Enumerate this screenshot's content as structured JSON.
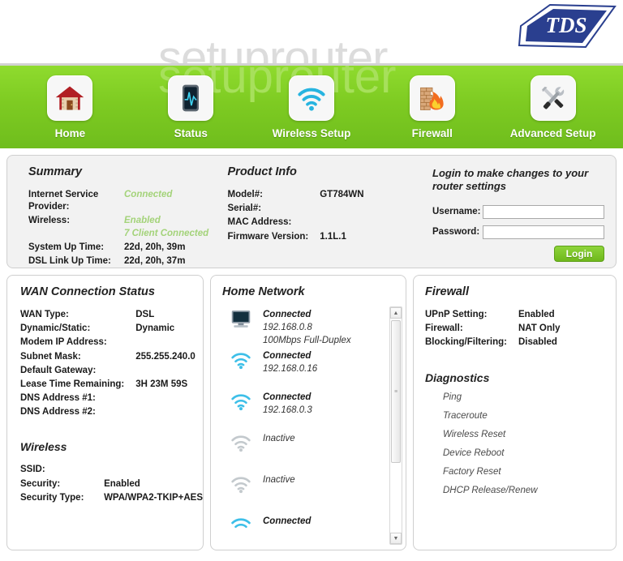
{
  "header": {
    "brand": "TDS",
    "watermark": "setuprouter"
  },
  "nav": {
    "items": [
      {
        "label": "Home",
        "icon": "house-icon"
      },
      {
        "label": "Status",
        "icon": "pulse-monitor-icon"
      },
      {
        "label": "Wireless Setup",
        "icon": "wifi-icon"
      },
      {
        "label": "Firewall",
        "icon": "firewall-flame-icon"
      },
      {
        "label": "Advanced Setup",
        "icon": "tools-icon"
      }
    ]
  },
  "summary": {
    "title": "Summary",
    "rows": [
      {
        "key": "Internet Service Provider:",
        "value": "Connected",
        "style": "green"
      },
      {
        "key": "Wireless:",
        "value": "Enabled\n7 Client Connected",
        "style": "green"
      },
      {
        "key": "System Up Time:",
        "value": "22d, 20h, 39m",
        "style": "plain"
      },
      {
        "key": "DSL Link Up Time:",
        "value": "22d, 20h, 37m",
        "style": "plain"
      }
    ]
  },
  "product_info": {
    "title": "Product Info",
    "rows": [
      {
        "key": "Model#:",
        "value": "GT784WN"
      },
      {
        "key": "Serial#:",
        "value": ""
      },
      {
        "key": "MAC Address:",
        "value": ""
      },
      {
        "key": "Firmware Version:",
        "value": "1.1L.1"
      }
    ]
  },
  "login": {
    "title": "Login to make changes to your router settings",
    "username_label": "Username:",
    "username_value": "",
    "username_placeholder": "",
    "password_label": "Password:",
    "password_value": "",
    "password_placeholder": "",
    "button_label": "Login",
    "button_color": "#7ec81f"
  },
  "wan": {
    "title": "WAN Connection Status",
    "rows": [
      {
        "key": "WAN Type:",
        "value": "DSL"
      },
      {
        "key": "Dynamic/Static:",
        "value": "Dynamic"
      },
      {
        "key": "Modem IP Address:",
        "value": ""
      },
      {
        "key": "Subnet Mask:",
        "value": "255.255.240.0"
      },
      {
        "key": "Default Gateway:",
        "value": ""
      },
      {
        "key": "Lease Time Remaining:",
        "value": "3H 23M 59S"
      },
      {
        "key": "DNS Address #1:",
        "value": ""
      },
      {
        "key": "DNS Address #2:",
        "value": ""
      }
    ],
    "wireless_title": "Wireless",
    "wireless_rows": [
      {
        "key": "SSID:",
        "value": ""
      },
      {
        "key": "Security:",
        "value": "Enabled"
      },
      {
        "key": "Security Type:",
        "value": "WPA/WPA2-TKIP+AES"
      }
    ]
  },
  "home_network": {
    "title": "Home Network",
    "devices": [
      {
        "icon": "computer-icon",
        "status": "Connected",
        "ip": "192.168.0.8",
        "speed": "100Mbps Full-Duplex",
        "active": true
      },
      {
        "icon": "wifi-icon",
        "status": "Connected",
        "ip": "192.168.0.16",
        "speed": "",
        "active": true
      },
      {
        "icon": "wifi-icon",
        "status": "Connected",
        "ip": "192.168.0.3",
        "speed": "",
        "active": true
      },
      {
        "icon": "wifi-icon",
        "status": "Inactive",
        "ip": "",
        "speed": "",
        "active": false
      },
      {
        "icon": "wifi-icon",
        "status": "Inactive",
        "ip": "",
        "speed": "",
        "active": false
      },
      {
        "icon": "wifi-icon",
        "status": "Connected",
        "ip": "",
        "speed": "",
        "active": true
      }
    ]
  },
  "firewall": {
    "title": "Firewall",
    "rows": [
      {
        "key": "UPnP Setting:",
        "value": "Enabled"
      },
      {
        "key": "Firewall:",
        "value": "NAT Only"
      },
      {
        "key": "Blocking/Filtering:",
        "value": "Disabled"
      }
    ],
    "diagnostics_title": "Diagnostics",
    "diagnostics": [
      "Ping",
      "Traceroute",
      "Wireless Reset",
      "Device Reboot",
      "Factory Reset",
      "DHCP Release/Renew"
    ]
  }
}
